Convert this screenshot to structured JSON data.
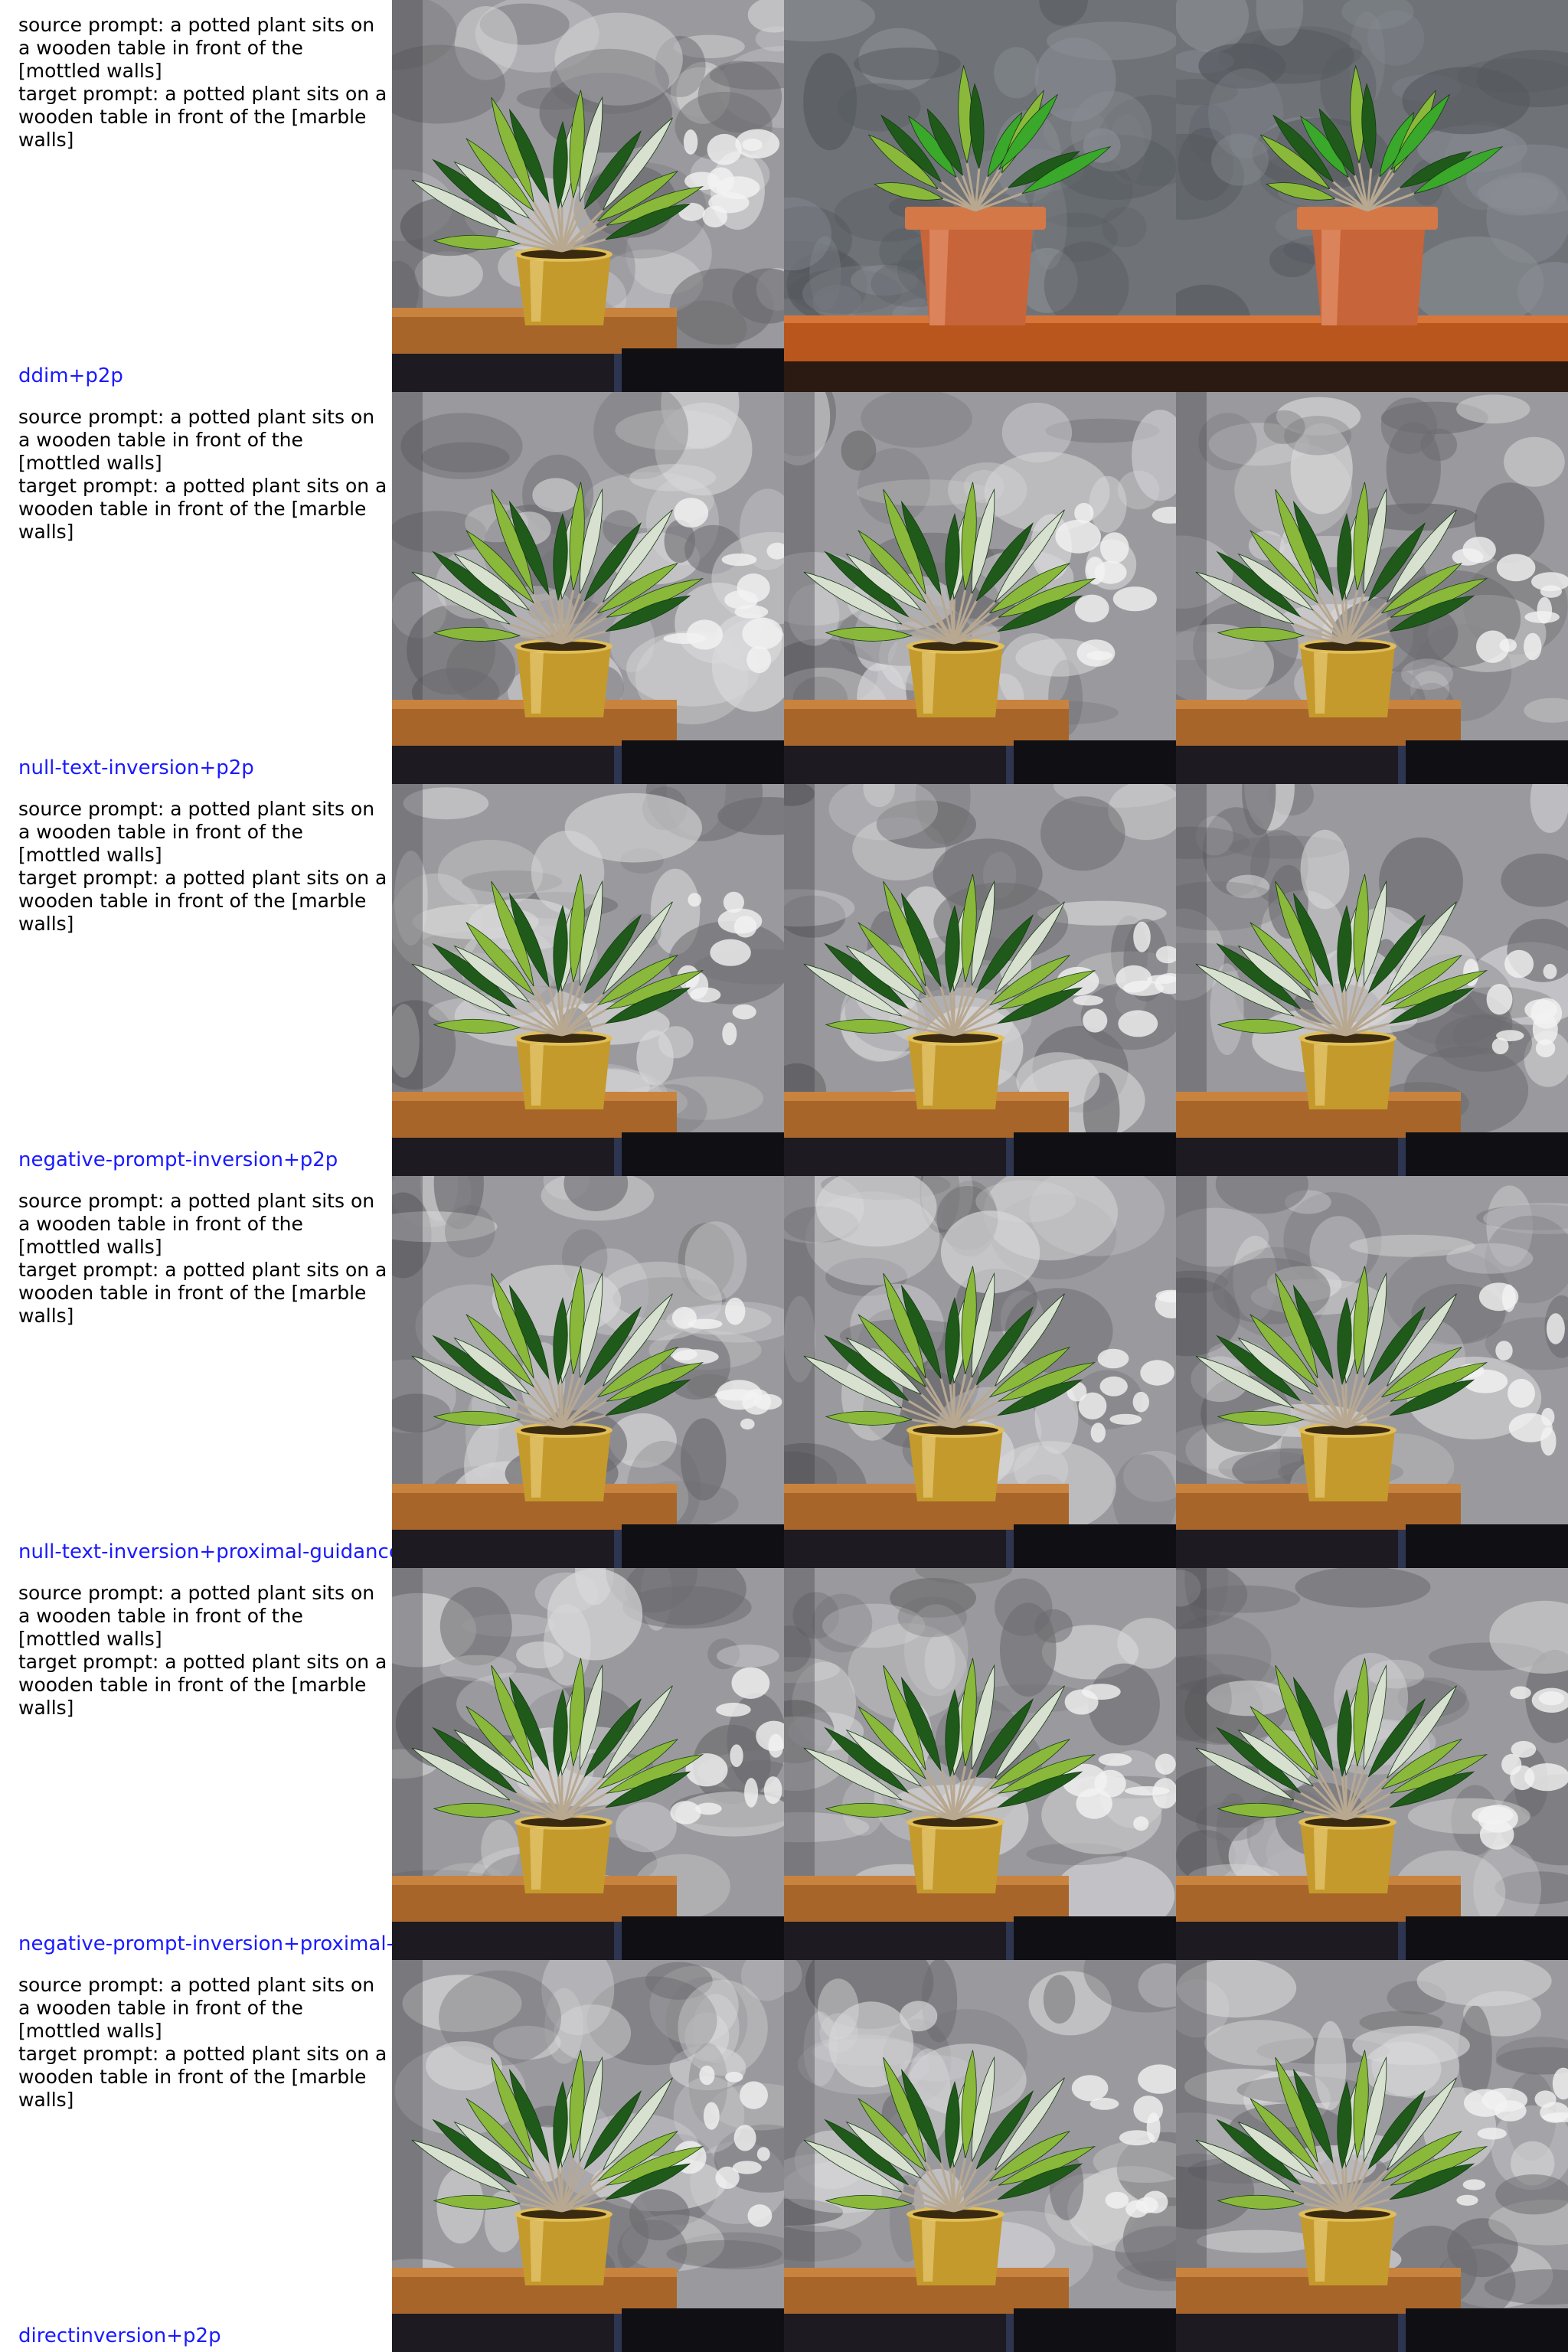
{
  "rows": [
    {
      "prompt": "source prompt: a potted plant sits on\na wooden table in front of the\n[mottled walls]\ntarget prompt: a potted plant sits on a\nwooden table in front of the [marble\nwalls]",
      "method": "ddim+p2p",
      "images": [
        {
          "subject": "potted plant in gold pot on wooden table, mottled grey wall",
          "pot_color": "#c49a2c",
          "wall_style": "mottled"
        },
        {
          "subject": "potted plant in terracotta pot on orange wooden table, dark grey textured wall",
          "pot_color": "#c8643a",
          "wall_style": "textured"
        },
        {
          "subject": "potted plant in terracotta pot on orange wooden table, dark grey textured wall",
          "pot_color": "#c8643a",
          "wall_style": "textured"
        }
      ]
    },
    {
      "prompt": "source prompt: a potted plant sits on\na wooden table in front of the\n[mottled walls]\ntarget prompt: a potted plant sits on a\nwooden table in front of the [marble\nwalls]",
      "method": "null-text-inversion+p2p",
      "images": [
        {
          "subject": "potted plant in gold pot on wooden table, mottled grey wall",
          "pot_color": "#c49a2c",
          "wall_style": "mottled"
        },
        {
          "subject": "potted plant in gold pot on wooden table, mottled grey wall",
          "pot_color": "#c49a2c",
          "wall_style": "mottled"
        },
        {
          "subject": "potted plant in gold pot on wooden table, mottled grey wall",
          "pot_color": "#c49a2c",
          "wall_style": "mottled"
        }
      ]
    },
    {
      "prompt": "source prompt: a potted plant sits on\na wooden table in front of the\n[mottled walls]\ntarget prompt: a potted plant sits on a\nwooden table in front of the [marble\nwalls]",
      "method": "negative-prompt-inversion+p2p",
      "images": [
        {
          "subject": "potted plant in gold pot on wooden table, mottled grey wall",
          "pot_color": "#c49a2c",
          "wall_style": "mottled"
        },
        {
          "subject": "potted plant in gold pot on wooden table, mottled grey wall",
          "pot_color": "#c49a2c",
          "wall_style": "mottled"
        },
        {
          "subject": "potted plant in gold pot on wooden table, mottled grey wall",
          "pot_color": "#c49a2c",
          "wall_style": "mottled"
        }
      ]
    },
    {
      "prompt": "source prompt: a potted plant sits on\na wooden table in front of the\n[mottled walls]\ntarget prompt: a potted plant sits on a\nwooden table in front of the [marble\nwalls]",
      "method": "null-text-inversion+proximal-guidance",
      "images": [
        {
          "subject": "potted plant in gold pot on wooden table, mottled grey wall",
          "pot_color": "#c49a2c",
          "wall_style": "mottled"
        },
        {
          "subject": "potted plant in gold pot on wooden table, mottled grey wall",
          "pot_color": "#c49a2c",
          "wall_style": "mottled"
        },
        {
          "subject": "potted plant in gold pot on wooden table, mottled grey wall",
          "pot_color": "#c49a2c",
          "wall_style": "mottled"
        }
      ]
    },
    {
      "prompt": "source prompt: a potted plant sits on\na wooden table in front of the\n[mottled walls]\ntarget prompt: a potted plant sits on a\nwooden table in front of the [marble\nwalls]",
      "method": "negative-prompt-inversion+proximal-g",
      "images": [
        {
          "subject": "potted plant in gold pot on wooden table, mottled grey wall",
          "pot_color": "#c49a2c",
          "wall_style": "mottled"
        },
        {
          "subject": "potted plant in gold pot on wooden table, mottled grey wall",
          "pot_color": "#c49a2c",
          "wall_style": "mottled"
        },
        {
          "subject": "potted plant in gold pot on wooden table, mottled grey wall",
          "pot_color": "#c49a2c",
          "wall_style": "mottled"
        }
      ]
    },
    {
      "prompt": "source prompt: a potted plant sits on\na wooden table in front of the\n[mottled walls]\ntarget prompt: a potted plant sits on a\nwooden table in front of the [marble\nwalls]",
      "method": "directinversion+p2p",
      "images": [
        {
          "subject": "potted plant in gold pot on wooden table, mottled grey wall",
          "pot_color": "#c49a2c",
          "wall_style": "mottled"
        },
        {
          "subject": "potted plant in gold pot on wooden table, mottled grey wall",
          "pot_color": "#c49a2c",
          "wall_style": "mottled"
        },
        {
          "subject": "potted plant in gold pot on wooden table, mottled grey wall",
          "pot_color": "#c49a2c",
          "wall_style": "mottled"
        }
      ]
    }
  ],
  "colors": {
    "method_label": "#1a1aff",
    "prompt_text": "#000000",
    "gold_pot": "#c49a2c",
    "terracotta_pot": "#c8643a",
    "leaf_dark": "#1f5a1a",
    "leaf_light": "#8ab83a",
    "table_wood": "#a8652a",
    "wall_grey": "#8e8e92"
  }
}
